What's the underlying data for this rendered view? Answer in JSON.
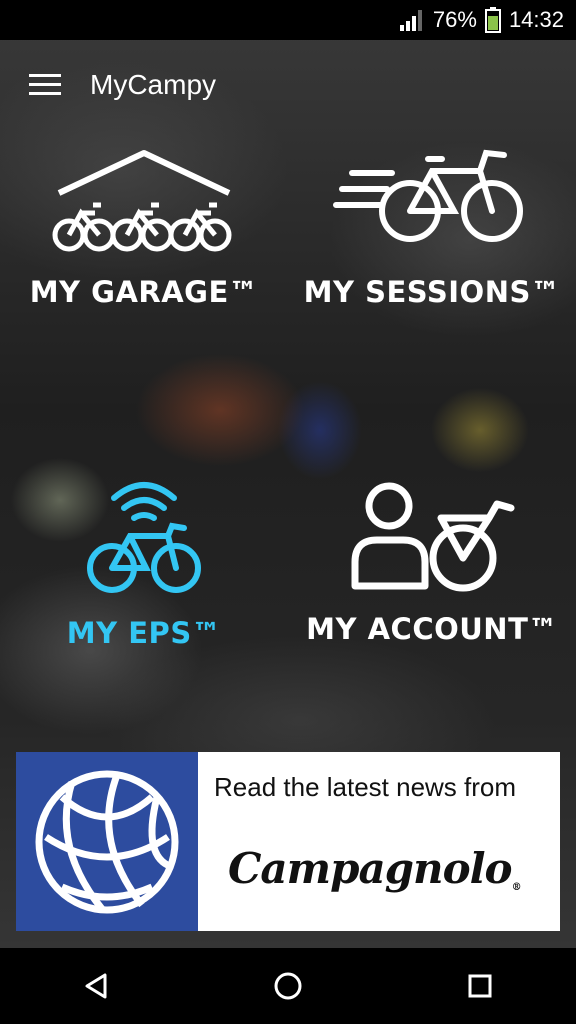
{
  "status_bar": {
    "battery_percent": "76%",
    "time": "14:32",
    "icons": [
      "signal-icon",
      "battery-icon"
    ]
  },
  "app_bar": {
    "title": "MyCampy",
    "menu_icon": "hamburger-menu-icon"
  },
  "tiles": [
    {
      "id": "garage",
      "label": "MY GARAGE™",
      "icon": "garage-bikes-icon",
      "color": "#ffffff"
    },
    {
      "id": "sessions",
      "label": "MY SESSIONS™",
      "icon": "speeding-bike-icon",
      "color": "#ffffff"
    },
    {
      "id": "eps",
      "label": "MY EPS™",
      "icon": "wireless-bike-icon",
      "color": "#33c6f3"
    },
    {
      "id": "account",
      "label": "MY ACCOUNT™",
      "icon": "user-bike-icon",
      "color": "#ffffff"
    }
  ],
  "banner": {
    "text": "Read the latest news from",
    "brand": "Campagnolo",
    "brand_mark": "®",
    "icon": "globe-icon",
    "logo_bg": "#2d4c9f"
  },
  "nav_bar": {
    "buttons": [
      "back-icon",
      "home-icon",
      "recents-icon"
    ]
  }
}
